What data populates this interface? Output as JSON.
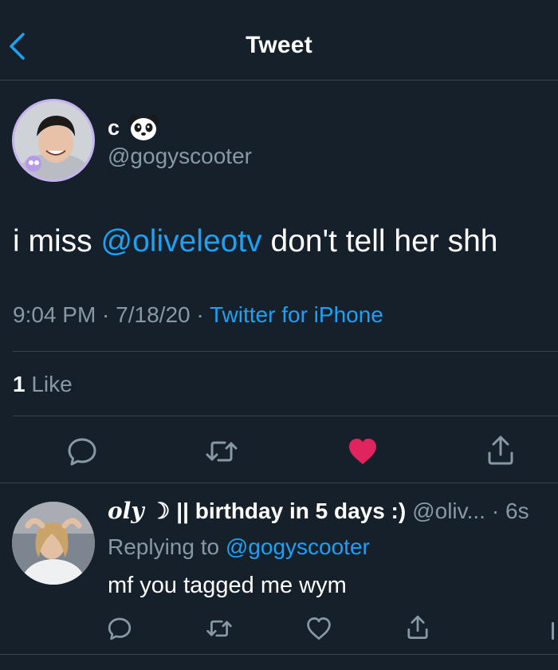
{
  "header": {
    "title": "Tweet",
    "back_icon": "chevron-left-icon"
  },
  "tweet": {
    "display_name": "c",
    "display_emoji": "panda-emoji",
    "username": "@gogyscooter",
    "text_before": "i miss ",
    "mention": "@oliveleotv",
    "text_after": " don't tell her shh",
    "time": "9:04 PM",
    "sep1": " · ",
    "date": "7/18/20",
    "sep2": " · ",
    "source": "Twitter for iPhone",
    "likes_count": "1",
    "likes_label": " Like",
    "liked": true
  },
  "reply": {
    "name_italic": "oly",
    "name_symbol": "☽",
    "name_rest": " || birthday in 5 days :)",
    "handle": "@oliv...",
    "time": "· 6s",
    "replying_prefix": "Replying to ",
    "replying_mention": "@gogyscooter",
    "text": "mf you tagged me wym"
  },
  "colors": {
    "background": "#15202b",
    "accent": "#1da1f2",
    "muted": "#8899a6",
    "divider": "#38444d",
    "like": "#e0245e"
  }
}
